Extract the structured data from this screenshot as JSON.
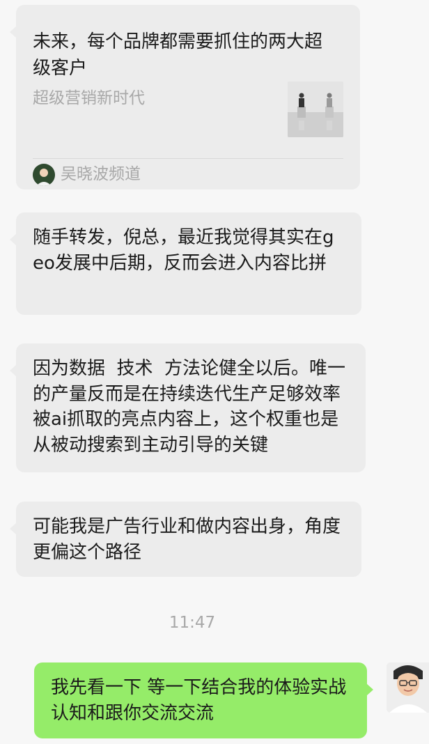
{
  "link_card": {
    "title": "未来，每个品牌都需要抓住的两大超级客户",
    "description": "超级营销新时代",
    "thumbnail": "two-figures-on-stools-photo",
    "source_name": "吴晓波频道",
    "source_avatar": "channel-avatar-photo"
  },
  "messages": [
    {
      "text": "随手转发，倪总，最近我觉得其实在geo发展中后期，反而会进入内容比拼"
    },
    {
      "text": "因为数据  技术  方法论健全以后。唯一的产量反而是在持续迭代生产足够效率被ai抓取的亮点内容上，这个权重也是从被动搜索到主动引导的关键"
    },
    {
      "text": "可能我是广告行业和做内容出身，角度更偏这个路径"
    }
  ],
  "timestamp": "11:47",
  "outgoing": {
    "text": "我先看一下 等一下结合我的体验实战认知和跟你交流交流"
  },
  "colors": {
    "background": "#f7f7f7",
    "incoming_bubble": "#ececec",
    "outgoing_bubble": "#95ec69",
    "muted_text": "#a8a8a8"
  }
}
